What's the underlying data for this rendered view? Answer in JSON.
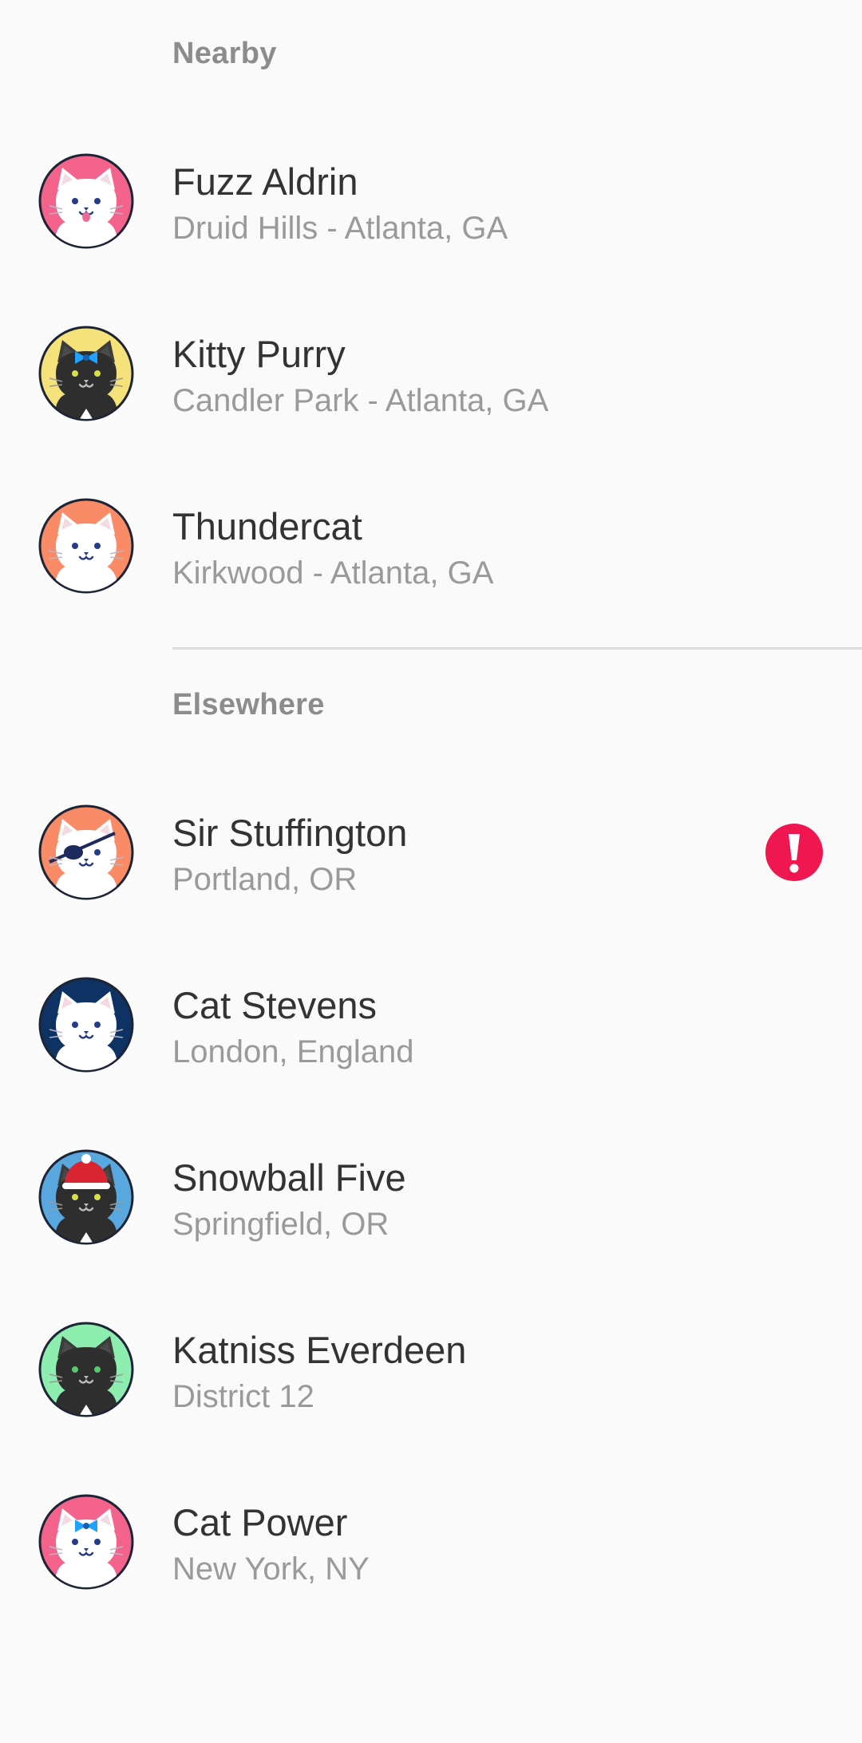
{
  "sections": [
    {
      "header": "Nearby",
      "contacts": [
        {
          "name": "Fuzz Aldrin",
          "location": "Druid Hills - Atlanta, GA",
          "avatar_bg": "#f4638c",
          "cat_color": "white",
          "accessory": "tongue"
        },
        {
          "name": "Kitty Purry",
          "location": "Candler Park - Atlanta, GA",
          "avatar_bg": "#f6e27a",
          "cat_color": "black",
          "accessory": "bow"
        },
        {
          "name": "Thundercat",
          "location": "Kirkwood - Atlanta, GA",
          "avatar_bg": "#f98b66",
          "cat_color": "white",
          "accessory": "none"
        }
      ]
    },
    {
      "header": "Elsewhere",
      "contacts": [
        {
          "name": "Sir Stuffington",
          "location": "Portland, OR",
          "avatar_bg": "#f98b66",
          "cat_color": "white",
          "accessory": "eyepatch",
          "alert": true
        },
        {
          "name": "Cat Stevens",
          "location": "London, England",
          "avatar_bg": "#0e3263",
          "cat_color": "white",
          "accessory": "none"
        },
        {
          "name": "Snowball Five",
          "location": "Springfield, OR",
          "avatar_bg": "#58a8df",
          "cat_color": "black",
          "accessory": "santa-hat"
        },
        {
          "name": "Katniss Everdeen",
          "location": "District 12",
          "avatar_bg": "#8eeeb0",
          "cat_color": "black",
          "accessory": "none"
        },
        {
          "name": "Cat Power",
          "location": "New York, NY",
          "avatar_bg": "#f4638c",
          "cat_color": "white",
          "accessory": "bow"
        }
      ]
    }
  ],
  "colors": {
    "alert": "#f0164f",
    "name_text": "#333333",
    "subtitle_text": "#9a9a9a",
    "header_text": "#8c8c8c"
  },
  "icons": {
    "alert": "exclamation-circle-icon",
    "avatar": "cat-face-icon"
  }
}
